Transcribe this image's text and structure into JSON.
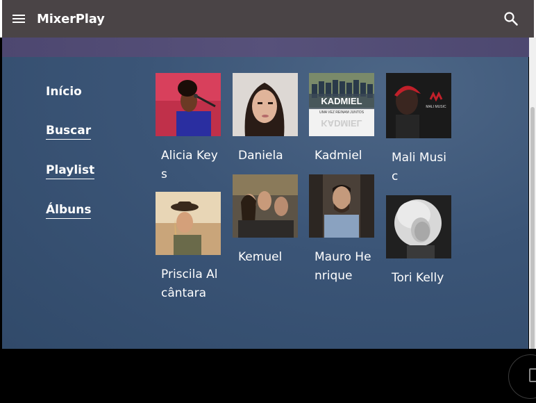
{
  "app": {
    "title": "MixerPlay"
  },
  "nav": {
    "items": [
      {
        "label": "Início"
      },
      {
        "label": "Buscar"
      },
      {
        "label": "Playlist"
      },
      {
        "label": "Álbuns"
      }
    ]
  },
  "artists": [
    {
      "name": "Alicia Keys"
    },
    {
      "name": "Daniela"
    },
    {
      "name": "Kadmiel"
    },
    {
      "name": "Mali Music"
    },
    {
      "name": "Priscila Alcântara"
    },
    {
      "name": "Kemuel"
    },
    {
      "name": "Mauro Henrique"
    },
    {
      "name": "Tori Kelly"
    }
  ],
  "album_art_text": {
    "kadmiel_cover_title": "KADMIEL",
    "kadmiel_cover_sub": "UMA VEZ REINAM JUNTOS",
    "mali_cover_title": "MALI MUSIC"
  }
}
